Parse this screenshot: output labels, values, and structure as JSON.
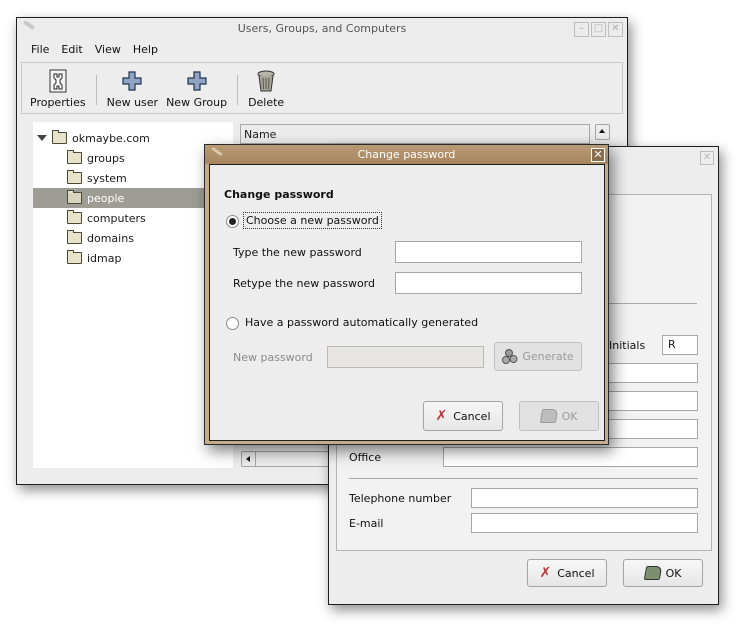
{
  "main_window": {
    "title": "Users, Groups, and Computers",
    "window_buttons": [
      "minimize",
      "maximize",
      "close"
    ],
    "menu": [
      {
        "label": "File",
        "mnemonic": "F"
      },
      {
        "label": "Edit",
        "mnemonic": "E"
      },
      {
        "label": "View",
        "mnemonic": "V"
      },
      {
        "label": "Help",
        "mnemonic": "H"
      }
    ],
    "toolbar": {
      "properties": "Properties",
      "new_user": "New user",
      "new_group": "New Group",
      "delete": "Delete"
    },
    "tree": {
      "root": "okmaybe.com",
      "children": [
        "groups",
        "system",
        "people",
        "computers",
        "domains",
        "idmap"
      ],
      "selected": "people"
    },
    "list": {
      "columns": [
        "Name"
      ]
    }
  },
  "properties_window": {
    "fields": {
      "initials_label": "Initials",
      "initials_value": "R",
      "office_label": "Office",
      "telephone_label": "Telephone number",
      "email_label": "E-mail"
    },
    "buttons": {
      "cancel": "Cancel",
      "ok": "OK"
    }
  },
  "change_password_dialog": {
    "title": "Change password",
    "heading": "Change password",
    "option_choose": "Choose a new password",
    "option_choose_selected": true,
    "type_label": "Type the new password",
    "type_value": "",
    "retype_label": "Retype the new password",
    "retype_value": "",
    "option_generate": "Have a password automatically generated",
    "option_generate_selected": false,
    "new_password_label": "New password",
    "new_password_value": "",
    "generate_button": "Generate",
    "cancel_button": "Cancel",
    "ok_button": "OK"
  }
}
